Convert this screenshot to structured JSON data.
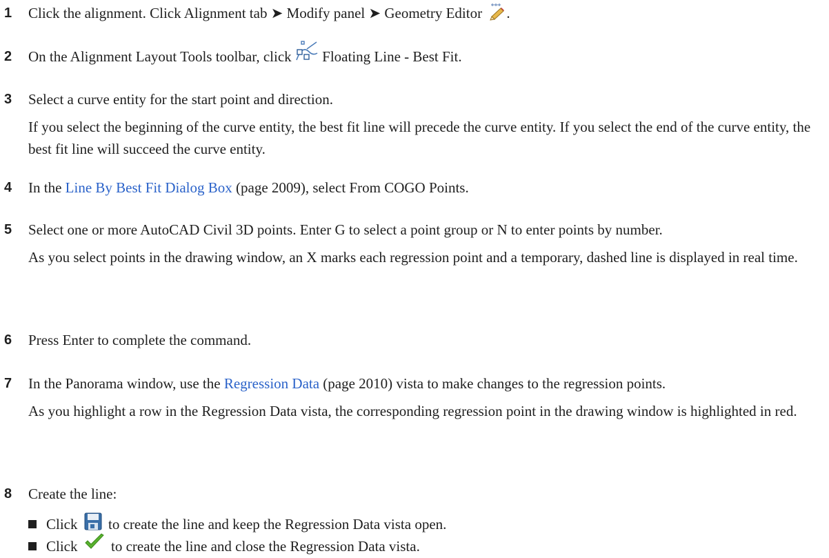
{
  "steps": [
    {
      "number": "1",
      "text_before": "Click the alignment. Click Alignment tab ➤ Modify panel ➤ Geometry Editor ",
      "icon": "geometry-editor-pencil-icon",
      "text_after": "."
    },
    {
      "number": "2",
      "text_before": "On the Alignment Layout Tools toolbar, click ",
      "icon": "floating-line-best-fit-icon",
      "text_after": " Floating Line - Best Fit."
    },
    {
      "number": "3",
      "text": "Select a curve entity for the start point and direction.",
      "note": "If you select the beginning of the curve entity, the best fit line will precede the curve entity. If you select the end of the curve entity, the best fit line will succeed the curve entity."
    },
    {
      "number": "4",
      "text_before": "In the ",
      "link": "Line By Best Fit Dialog Box",
      "text_after": " (page 2009), select From COGO Points."
    },
    {
      "number": "5",
      "text": "Select one or more AutoCAD Civil 3D points. Enter G to select a point group or N to enter points by number.",
      "note": "As you select points in the drawing window, an X marks each regression point and a temporary, dashed line is displayed in real time."
    },
    {
      "number": "6",
      "text": "Press Enter to complete the command."
    },
    {
      "number": "7",
      "text_before": "In the Panorama window, use the ",
      "link": "Regression Data",
      "text_after": " (page 2010) vista to make changes to the regression points.",
      "note": "As you highlight a row in the Regression Data vista, the corresponding regression point in the drawing window is highlighted in red."
    },
    {
      "number": "8",
      "text": "Create the line:",
      "bullets": [
        {
          "text_before": "Click ",
          "icon": "save-floppy-icon",
          "text_after": " to create the line and keep the Regression Data vista open."
        },
        {
          "text_before": "Click ",
          "icon": "green-checkmark-icon",
          "text_after": " to create the line and close the Regression Data vista."
        }
      ]
    }
  ],
  "colors": {
    "text": "#1f1f1f",
    "link": "#2a62c9",
    "check": "#58b22e",
    "floppy": "#3a6fa8"
  }
}
